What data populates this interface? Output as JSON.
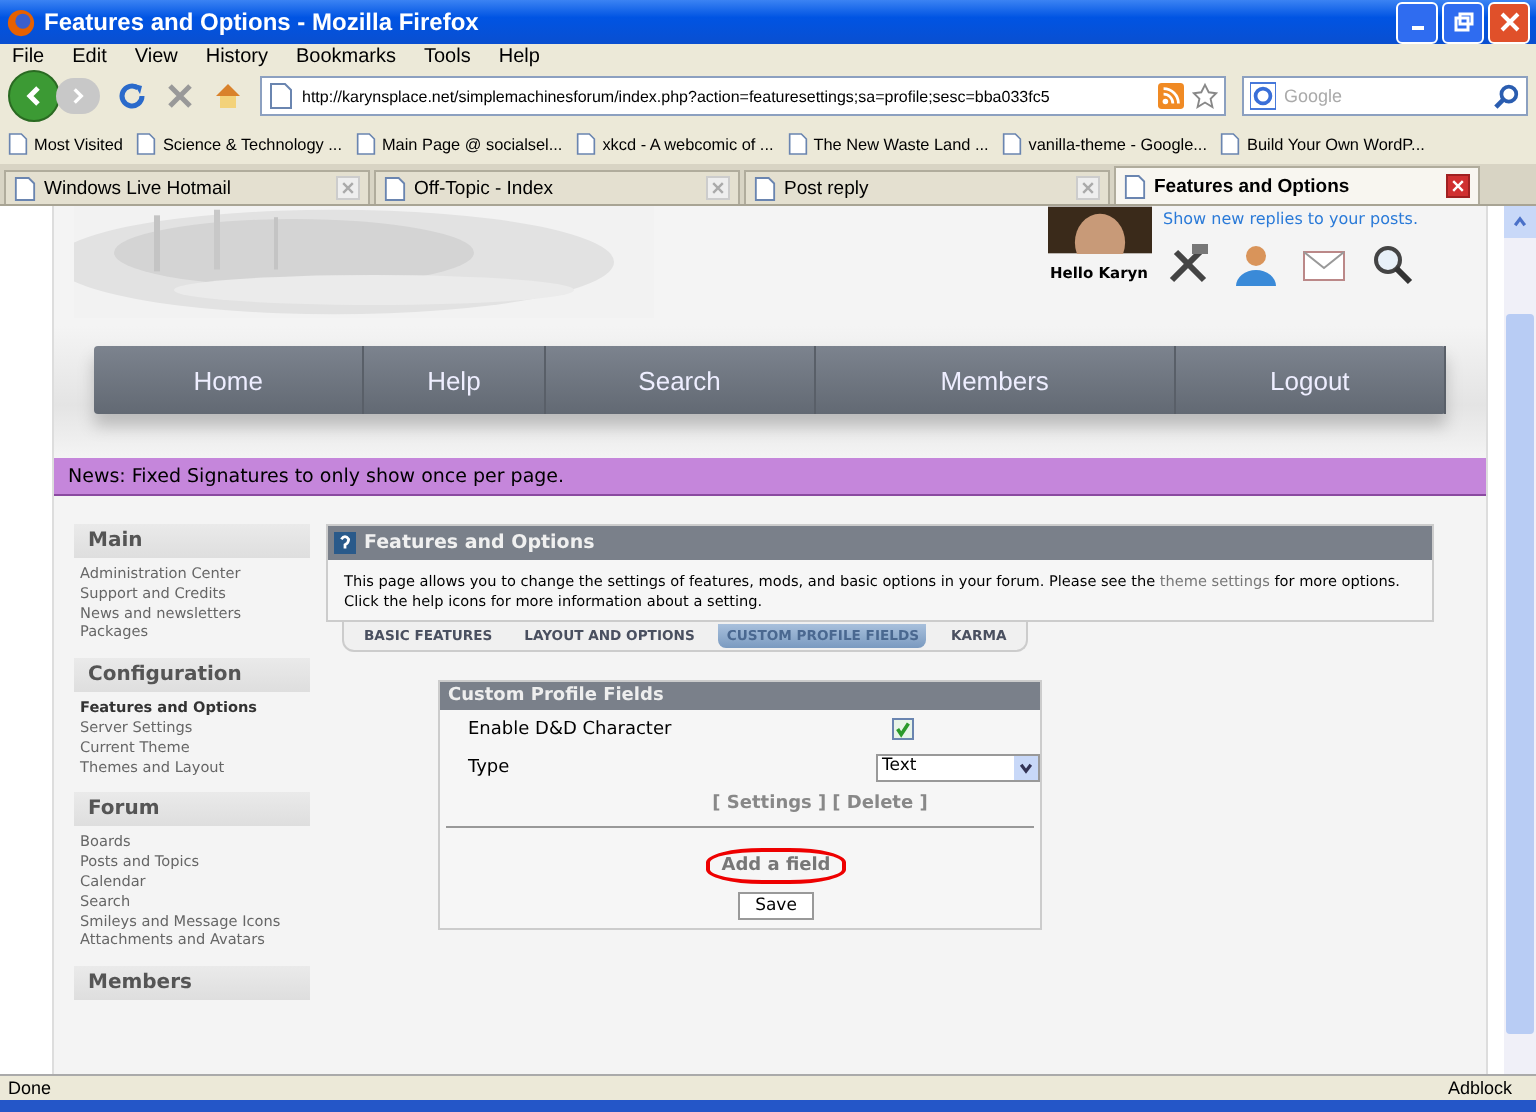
{
  "window": {
    "title": "Features and Options - Mozilla Firefox"
  },
  "menu": [
    "File",
    "Edit",
    "View",
    "History",
    "Bookmarks",
    "Tools",
    "Help"
  ],
  "toolbar": {
    "url": "http://karynsplace.net/simplemachinesforum/index.php?action=featuresettings;sa=profile;sesc=bba033fc5",
    "search_placeholder": "Google"
  },
  "bookmarks": [
    "Most Visited",
    "Science & Technology ...",
    "Main Page @ socialsel...",
    "xkcd - A webcomic of ...",
    "The New Waste Land ...",
    "vanilla-theme - Google...",
    "Build Your Own WordP..."
  ],
  "tabs": [
    {
      "label": "Windows Live Hotmail",
      "selected": false
    },
    {
      "label": "Off-Topic - Index",
      "selected": false
    },
    {
      "label": "Post reply",
      "selected": false
    },
    {
      "label": "Features and Options",
      "selected": true
    }
  ],
  "header": {
    "greeting": "Hello Karyn",
    "link": "Show new replies to your posts."
  },
  "nav": [
    "Home",
    "Help",
    "Search",
    "Members",
    "Logout"
  ],
  "news": "News: Fixed Signatures to only show once per page.",
  "sidebar": [
    {
      "title": "Main",
      "items": [
        {
          "label": "Administration Center",
          "selected": false
        },
        {
          "label": "Support and Credits",
          "selected": false
        },
        {
          "label": "News and newsletters",
          "selected": false
        },
        {
          "label": "Packages",
          "selected": false
        }
      ]
    },
    {
      "title": "Configuration",
      "items": [
        {
          "label": "Features and Options",
          "selected": true
        },
        {
          "label": "Server Settings",
          "selected": false
        },
        {
          "label": "Current Theme",
          "selected": false
        },
        {
          "label": "Themes and Layout",
          "selected": false
        }
      ]
    },
    {
      "title": "Forum",
      "items": [
        {
          "label": "Boards",
          "selected": false
        },
        {
          "label": "Posts and Topics",
          "selected": false
        },
        {
          "label": "Calendar",
          "selected": false
        },
        {
          "label": "Search",
          "selected": false
        },
        {
          "label": "Smileys and Message Icons",
          "selected": false
        },
        {
          "label": "Attachments and Avatars",
          "selected": false
        }
      ]
    },
    {
      "title": "Members"
    }
  ],
  "panel": {
    "title": "Features and Options",
    "description_before": "This page allows you to change the settings of features, mods, and basic options in your forum. Please see the",
    "description_link": "theme settings",
    "description_after": "for more options. Click the help icons for more information about a setting."
  },
  "settings_tabs": [
    {
      "label": "BASIC FEATURES",
      "selected": false
    },
    {
      "label": "LAYOUT AND OPTIONS",
      "selected": false
    },
    {
      "label": "CUSTOM PROFILE FIELDS",
      "selected": true
    },
    {
      "label": "KARMA",
      "selected": false
    }
  ],
  "profile_fields": {
    "title": "Custom Profile Fields",
    "rows": [
      {
        "kind": "checkbox",
        "label": "Enable D&D Character",
        "checked": true
      },
      {
        "kind": "select",
        "label": "Type",
        "value": "Text"
      }
    ],
    "actions": [
      "[ Settings ]",
      "[ Delete ]"
    ],
    "add_field": "Add a field",
    "save": "Save"
  },
  "status": {
    "text": "Done",
    "addon": "Adblock"
  }
}
